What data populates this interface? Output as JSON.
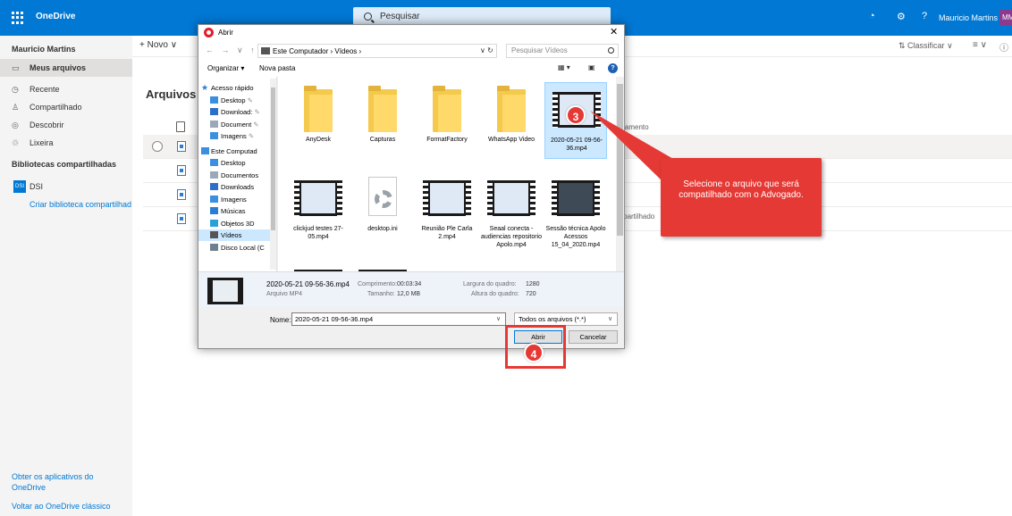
{
  "app": {
    "brand": "OneDrive",
    "search_placeholder": "Pesquisar",
    "user_name": "Mauricio Martins",
    "avatar_initials": "MM"
  },
  "nav": {
    "user": "Mauricio Martins",
    "items": [
      {
        "label": "Meus arquivos",
        "icon": "folder-icon"
      },
      {
        "label": "Recente",
        "icon": "clock-icon"
      },
      {
        "label": "Compartilhado",
        "icon": "people-icon"
      },
      {
        "label": "Descobrir",
        "icon": "compass-icon"
      },
      {
        "label": "Lixeira",
        "icon": "trash-icon"
      }
    ],
    "section_title": "Bibliotecas compartilhadas",
    "library": {
      "label": "DSI",
      "badge": "DSI"
    },
    "create_library": "Criar biblioteca compartilhad",
    "footer": [
      "Obter os aplicativos do OneDrive",
      "Voltar ao OneDrive clássico"
    ]
  },
  "commandbar": {
    "new_label": "+ Novo",
    "sort_label": "Classificar"
  },
  "main": {
    "title": "Arquivos",
    "sharing_header": "rtilhamento",
    "sharing_cell": "ompartilhado"
  },
  "dialog": {
    "title": "Abrir",
    "path": "Este Computador  ›  Vídeos  ›",
    "search_placeholder": "Pesquisar Vídeos",
    "toolbar": {
      "organize": "Organizar ▾",
      "new_folder": "Nova pasta"
    },
    "tree": [
      {
        "label": "Acesso rápido",
        "icon": "star-icon",
        "level": 0,
        "color": "#2b7cd3"
      },
      {
        "label": "Desktop",
        "icon": "desktop-icon",
        "level": 1,
        "color": "#3a8fe0",
        "pin": true
      },
      {
        "label": "Download:",
        "icon": "download-icon",
        "level": 1,
        "color": "#2b6fc9",
        "pin": true
      },
      {
        "label": "Document",
        "icon": "document-icon",
        "level": 1,
        "color": "#9aa8b8",
        "pin": true
      },
      {
        "label": "Imagens",
        "icon": "image-icon",
        "level": 1,
        "color": "#3a8fe0",
        "pin": true
      },
      {
        "label": "Este Computad",
        "icon": "computer-icon",
        "level": 0,
        "color": "#3a8fe0"
      },
      {
        "label": "Desktop",
        "icon": "desktop-icon",
        "level": 1,
        "color": "#3a8fe0"
      },
      {
        "label": "Documentos",
        "icon": "document-icon",
        "level": 1,
        "color": "#9aa8b8"
      },
      {
        "label": "Downloads",
        "icon": "download-icon",
        "level": 1,
        "color": "#2b6fc9"
      },
      {
        "label": "Imagens",
        "icon": "image-icon",
        "level": 1,
        "color": "#3a8fe0"
      },
      {
        "label": "Músicas",
        "icon": "music-icon",
        "level": 1,
        "color": "#2b7cd3"
      },
      {
        "label": "Objetos 3D",
        "icon": "cube-icon",
        "level": 1,
        "color": "#2aa0d8"
      },
      {
        "label": "Vídeos",
        "icon": "video-folder-icon",
        "level": 1,
        "color": "#555555",
        "selected": true
      },
      {
        "label": "Disco Local (C",
        "icon": "drive-icon",
        "level": 1,
        "color": "#6f7f8f"
      }
    ],
    "files": [
      {
        "label": "AnyDesk",
        "kind": "folder"
      },
      {
        "label": "Capturas",
        "kind": "folder"
      },
      {
        "label": "FormatFactory",
        "kind": "folder"
      },
      {
        "label": "WhatsApp Video",
        "kind": "folder"
      },
      {
        "label": "2020-05-21 09-56-36.mp4",
        "kind": "video",
        "screen": "blue",
        "selected": true
      },
      {
        "label": "clickjud testes 27-05.mp4",
        "kind": "video",
        "screen": "blue"
      },
      {
        "label": "desktop.ini",
        "kind": "ini"
      },
      {
        "label": "Reunião Ple Carla 2.mp4",
        "kind": "video",
        "screen": "blue"
      },
      {
        "label": "Seaal conecta - audiencias repositorio Apolo.mp4",
        "kind": "video",
        "screen": "blue"
      },
      {
        "label": "Sessão técnica Apolo Acessos 15_04_2020.mp4",
        "kind": "video",
        "screen": "meet"
      },
      {
        "label": "",
        "kind": "video",
        "screen": "blue"
      },
      {
        "label": "",
        "kind": "video",
        "screen": "blue"
      }
    ],
    "details": {
      "name": "2020-05-21 09-56-36.mp4",
      "type": "Arquivo MP4",
      "length_label": "Comprimento:",
      "length": "00:03:34",
      "size_label": "Tamanho:",
      "size": "12,0 MB",
      "width_label": "Largura do quadro:",
      "width": "1280",
      "height_label": "Altura do quadro:",
      "height": "720"
    },
    "name_label": "Nome:",
    "name_value": "2020-05-21 09-56-36.mp4",
    "filter_value": "Todos os arquivos (*.*)",
    "open_button": "Abrir",
    "cancel_button": "Cancelar"
  },
  "annotations": {
    "step3": "3",
    "step4": "4",
    "callout_text": "Selecione o arquivo que será compatilhado com o Advogado.",
    "color": "#e53935"
  }
}
